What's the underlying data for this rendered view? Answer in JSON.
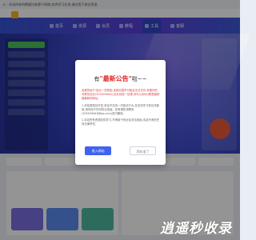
{
  "topbar": {
    "notice": "公 - 本站所有的数据均来源于网络,仅供学习交流,请勿用于商业用途"
  },
  "header": {
    "logo_text": "静金客栈"
  },
  "nav": {
    "items": [
      {
        "label": "首页",
        "icon": "home-icon"
      },
      {
        "label": "资源",
        "icon": "box-icon"
      },
      {
        "label": "会员",
        "icon": "crown-icon"
      },
      {
        "label": "教程",
        "icon": "book-icon"
      },
      {
        "label": "工具",
        "icon": "tool-icon"
      },
      {
        "label": "客服",
        "icon": "chat-icon"
      }
    ]
  },
  "watermark": {
    "text": "逍遥秒收录"
  },
  "modal": {
    "title_prefix": "有",
    "title_highlight": "\"最新公告\"",
    "title_suffix": "啦~~",
    "paragraph1": "亲爱的用户:因为一些原因,该网站暂时可能会无法访问,有疑问的可联系站长(305929646),站长将统一处理,你可以到QQ群里面获取最新的网址。",
    "paragraph2": "1.本站是原创开发,本站不支持一切违法行为,仅支持学习和交流使用,请勿用于任何商业用途。如有侵权请联系(305929646@qq.com)进行删除。",
    "paragraph3": "2.本站所有资源仅供学习,不得用于商业及非法用途,本站不承担任何法律责任。",
    "primary_button": "进入网站",
    "secondary_button": "我知道了"
  },
  "colors": {
    "nav_bg": "#4a4fd6",
    "primary_button": "#3f63f0",
    "highlight": "#e02a2a"
  }
}
